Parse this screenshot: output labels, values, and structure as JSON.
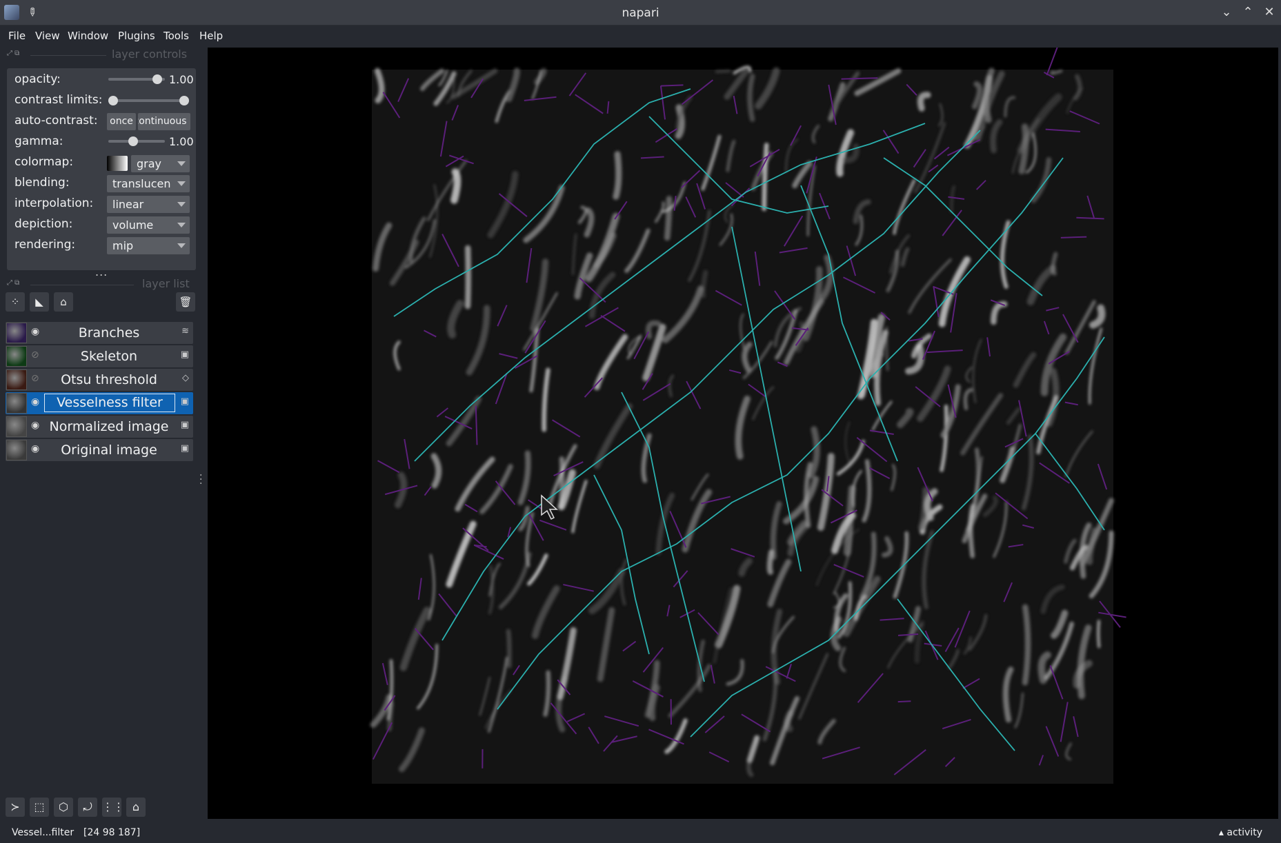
{
  "window": {
    "title": "napari",
    "icons": {
      "app": "napari-app-icon",
      "pin": "pin-icon",
      "minimize": "chevron-down-icon",
      "maximize": "chevron-up-icon",
      "close": "close-icon"
    }
  },
  "menubar": {
    "items": [
      {
        "label": "File",
        "underline": "F"
      },
      {
        "label": "View",
        "underline": "V"
      },
      {
        "label": "Window",
        "underline": "W"
      },
      {
        "label": "Plugins",
        "underline": "P"
      },
      {
        "label": "Tools",
        "underline": "T"
      },
      {
        "label": "Help",
        "underline": "H"
      }
    ]
  },
  "layer_controls": {
    "title": "layer controls",
    "opacity": {
      "label": "opacity:",
      "value": "1.00",
      "level": 1.0
    },
    "contrast_limits": {
      "label": "contrast limits:",
      "low": 0.0,
      "high": 1.0
    },
    "auto_contrast": {
      "label": "auto-contrast:",
      "once": "once",
      "continuous": "continuous"
    },
    "gamma": {
      "label": "gamma:",
      "value": "1.00",
      "level": 0.5
    },
    "colormap": {
      "label": "colormap:",
      "value": "gray"
    },
    "blending": {
      "label": "blending:",
      "value": "translucent"
    },
    "interpolation": {
      "label": "interpolation:",
      "value": "linear"
    },
    "depiction": {
      "label": "depiction:",
      "value": "volume"
    },
    "rendering": {
      "label": "rendering:",
      "value": "mip"
    },
    "more": "..."
  },
  "layer_list": {
    "title": "layer list",
    "tools": [
      {
        "name": "new-points-icon",
        "glyph": "⁘"
      },
      {
        "name": "new-shapes-icon",
        "glyph": "◣"
      },
      {
        "name": "new-labels-icon",
        "glyph": "⌂"
      }
    ],
    "delete_icon": "trash-icon",
    "layers": [
      {
        "name": "Branches",
        "visible": true,
        "selected": false,
        "type_icon": "shapes-layer-icon",
        "type_glyph": "≋",
        "thumb": "#2a1a4a"
      },
      {
        "name": "Skeleton",
        "visible": false,
        "selected": false,
        "type_icon": "image-layer-icon",
        "type_glyph": "▣",
        "thumb": "#0d3a14"
      },
      {
        "name": "Otsu threshold",
        "visible": false,
        "selected": false,
        "type_icon": "labels-layer-icon",
        "type_glyph": "◇",
        "thumb": "#3a1a12"
      },
      {
        "name": "Vesselness filter",
        "visible": true,
        "selected": true,
        "type_icon": "image-layer-icon",
        "type_glyph": "▣",
        "thumb": "#333"
      },
      {
        "name": "Normalized image",
        "visible": true,
        "selected": false,
        "type_icon": "image-layer-icon",
        "type_glyph": "▣",
        "thumb": "#444"
      },
      {
        "name": "Original image",
        "visible": true,
        "selected": false,
        "type_icon": "image-layer-icon",
        "type_glyph": "▣",
        "thumb": "#3a3a3a"
      }
    ]
  },
  "bottom_buttons": [
    {
      "name": "console-icon",
      "glyph": "≻"
    },
    {
      "name": "ndisplay-3d-icon",
      "glyph": "⬚"
    },
    {
      "name": "roll-dims-icon",
      "glyph": "⬡"
    },
    {
      "name": "transpose-icon",
      "glyph": "⤾"
    },
    {
      "name": "grid-icon",
      "glyph": "⋮⋮"
    },
    {
      "name": "home-icon",
      "glyph": "⌂"
    }
  ],
  "status": {
    "layer": "Vessel...filter",
    "coords": "[24 98 187]",
    "activity": "activity"
  },
  "colors": {
    "teal": "#2bb0ae",
    "purple": "#5b1f7a",
    "selected": "#0f62b1"
  }
}
